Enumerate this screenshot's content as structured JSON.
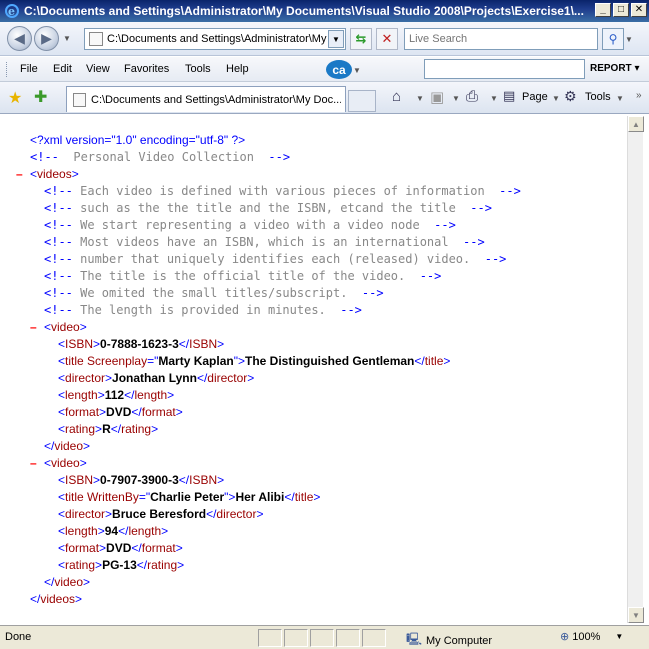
{
  "window": {
    "title": "C:\\Documents and Settings\\Administrator\\My Documents\\Visual Studio 2008\\Projects\\Exercise1\\..."
  },
  "navbar": {
    "address": "C:\\Documents and Settings\\Administrator\\My D",
    "search_placeholder": "Live Search"
  },
  "menu": {
    "items": [
      "File",
      "Edit",
      "View",
      "Favorites",
      "Tools",
      "Help"
    ],
    "report_label": "REPORT"
  },
  "tab": {
    "title": "C:\\Documents and Settings\\Administrator\\My Doc..."
  },
  "commandbar": {
    "page_label": "Page",
    "tools_label": "Tools"
  },
  "xml": {
    "declaration": "?xml version=\"1.0\" encoding=\"utf-8\" ?",
    "collection_comment": "  Personal Video Collection  ",
    "root_tag": "videos",
    "comments": [
      " Each video is defined with various pieces of information  ",
      " such as the the title and the ISBN, etcand the title  ",
      " We start representing a video with a video node  ",
      " Most videos have an ISBN, which is an international  ",
      " number that uniquely identifies each (released) video.  ",
      " The title is the official title of the video.  ",
      " We omited the small titles/subscript.  ",
      " The length is provided in minutes.  "
    ],
    "videos": [
      {
        "tag": "video",
        "isbn": "0-7888-1623-3",
        "title_attr": "Screenplay",
        "title_attr_value": "Marty Kaplan",
        "title": "The Distinguished Gentleman",
        "director": "Jonathan Lynn",
        "length": "112",
        "format": "DVD",
        "rating": "R"
      },
      {
        "tag": "video",
        "isbn": "0-7907-3900-3",
        "title_attr": "WrittenBy",
        "title_attr_value": "Charlie Peter",
        "title": "Her Alibi",
        "director": "Bruce Beresford",
        "length": "94",
        "format": "DVD",
        "rating": "PG-13"
      }
    ],
    "tags": {
      "isbn": "ISBN",
      "title": "title",
      "director": "director",
      "length": "length",
      "format": "format",
      "rating": "rating"
    }
  },
  "status": {
    "text": "Done",
    "zone": "My Computer",
    "zoom": "100%"
  },
  "colors": {
    "tag": "#0000ff",
    "tagname": "#990000",
    "comment": "#888888",
    "minus": "#ff0000"
  }
}
